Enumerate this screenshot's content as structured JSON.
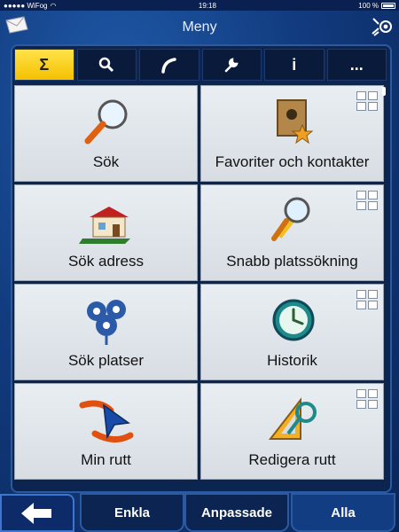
{
  "status": {
    "signal": "●●●●● WiFog",
    "time": "19:18",
    "battery": "100 %"
  },
  "header": {
    "title": "Meny"
  },
  "tabs": [
    {
      "label": "Σ",
      "name": "tab-summary"
    },
    {
      "label": "🔍",
      "name": "tab-search"
    },
    {
      "label": "↗",
      "name": "tab-route"
    },
    {
      "label": "🔧",
      "name": "tab-tools"
    },
    {
      "label": "i",
      "name": "tab-info"
    },
    {
      "label": "...",
      "name": "tab-more"
    }
  ],
  "tiles": [
    {
      "label": "Sök",
      "icon": "magnifier-icon"
    },
    {
      "label": "Favoriter och kontakter",
      "icon": "contacts-book-icon"
    },
    {
      "label": "Sök adress",
      "icon": "house-icon"
    },
    {
      "label": "Snabb platssökning",
      "icon": "magnifier-pin-icon"
    },
    {
      "label": "Sök platser",
      "icon": "places-pins-icon"
    },
    {
      "label": "Historik",
      "icon": "clock-icon"
    },
    {
      "label": "Min rutt",
      "icon": "route-arrow-icon"
    },
    {
      "label": "Redigera rutt",
      "icon": "edit-route-icon"
    }
  ],
  "bottom": {
    "enkla": "Enkla",
    "anpassade": "Anpassade",
    "alla": "Alla"
  }
}
